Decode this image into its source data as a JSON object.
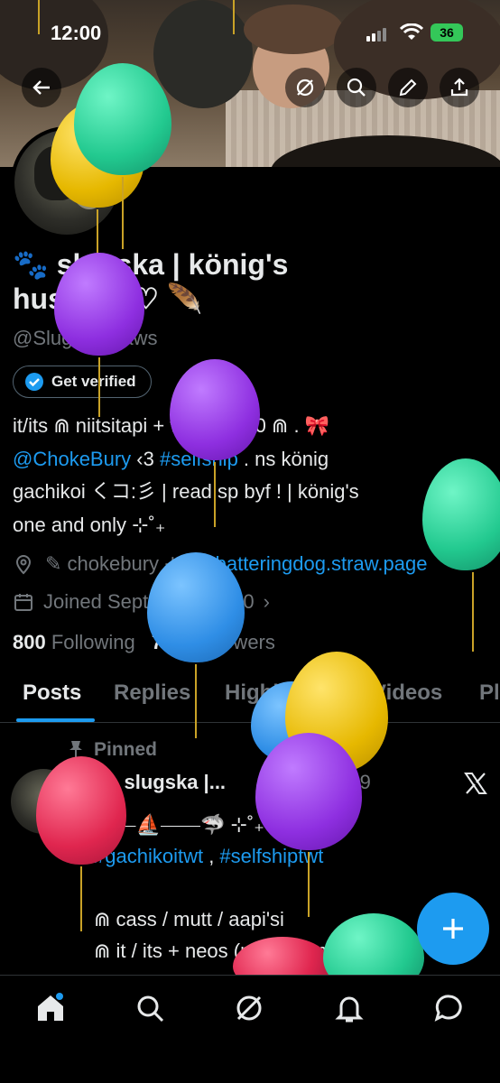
{
  "status_bar": {
    "time": "12:00",
    "battery": "36"
  },
  "profile": {
    "name_line1": "🐾 slugska | könig's",
    "name_line2": "husband♡ 🪶",
    "handle": "@SluggishPaws",
    "verify_label": "Get verified",
    "bio": {
      "line1": "it/its ⋒ niitsitapi + white ✦ 20 ⋒ . 🎀",
      "line2_mention": "@ChokeBury",
      "line2_mid": " ‹3 ",
      "line2_hashtag": "#selfship",
      "line2_end": " . ns könig",
      "line3": "gachikoi くコ:彡 | read sp byf ! | könig's",
      "line4": "one and only ⊹˚₊"
    },
    "location": "✎ chokebury ⊹",
    "website": "batteringdog.straw.page",
    "joined": "Joined September 2020",
    "following_count": "800",
    "following_label": "Following",
    "followers_count": "735",
    "followers_label": "Followers"
  },
  "tabs": [
    "Posts",
    "Replies",
    "Highlights",
    "Videos",
    "Pl"
  ],
  "pinned_post": {
    "pinned_label": "Pinned",
    "author": "🐾 slugska |...",
    "date": "2023-11-19",
    "line1": "⊹ ⎯⎯⛵⎯⎯⎯⎯🦈 ⊹˚₊ PINNED!",
    "line2_tag1": "#gachikoitwt",
    "line2_sep": " , ",
    "line2_tag2": "#selfshiptwt",
    "line3": "⋒ cass / mutt / aapi'si",
    "line4": "⋒ it / its + neos (masc terms only"
  },
  "colors": {
    "accent": "#1d9bf0",
    "background": "#000000",
    "muted": "#71767b"
  },
  "icons": [
    "back-arrow-icon",
    "grok-icon",
    "search-icon",
    "edit-icon",
    "share-icon",
    "verified-badge-icon",
    "location-icon",
    "link-icon",
    "calendar-icon",
    "pin-icon",
    "x-logo-icon",
    "plus-icon",
    "home-icon",
    "search-icon",
    "grok-icon",
    "bell-icon",
    "messages-icon"
  ]
}
